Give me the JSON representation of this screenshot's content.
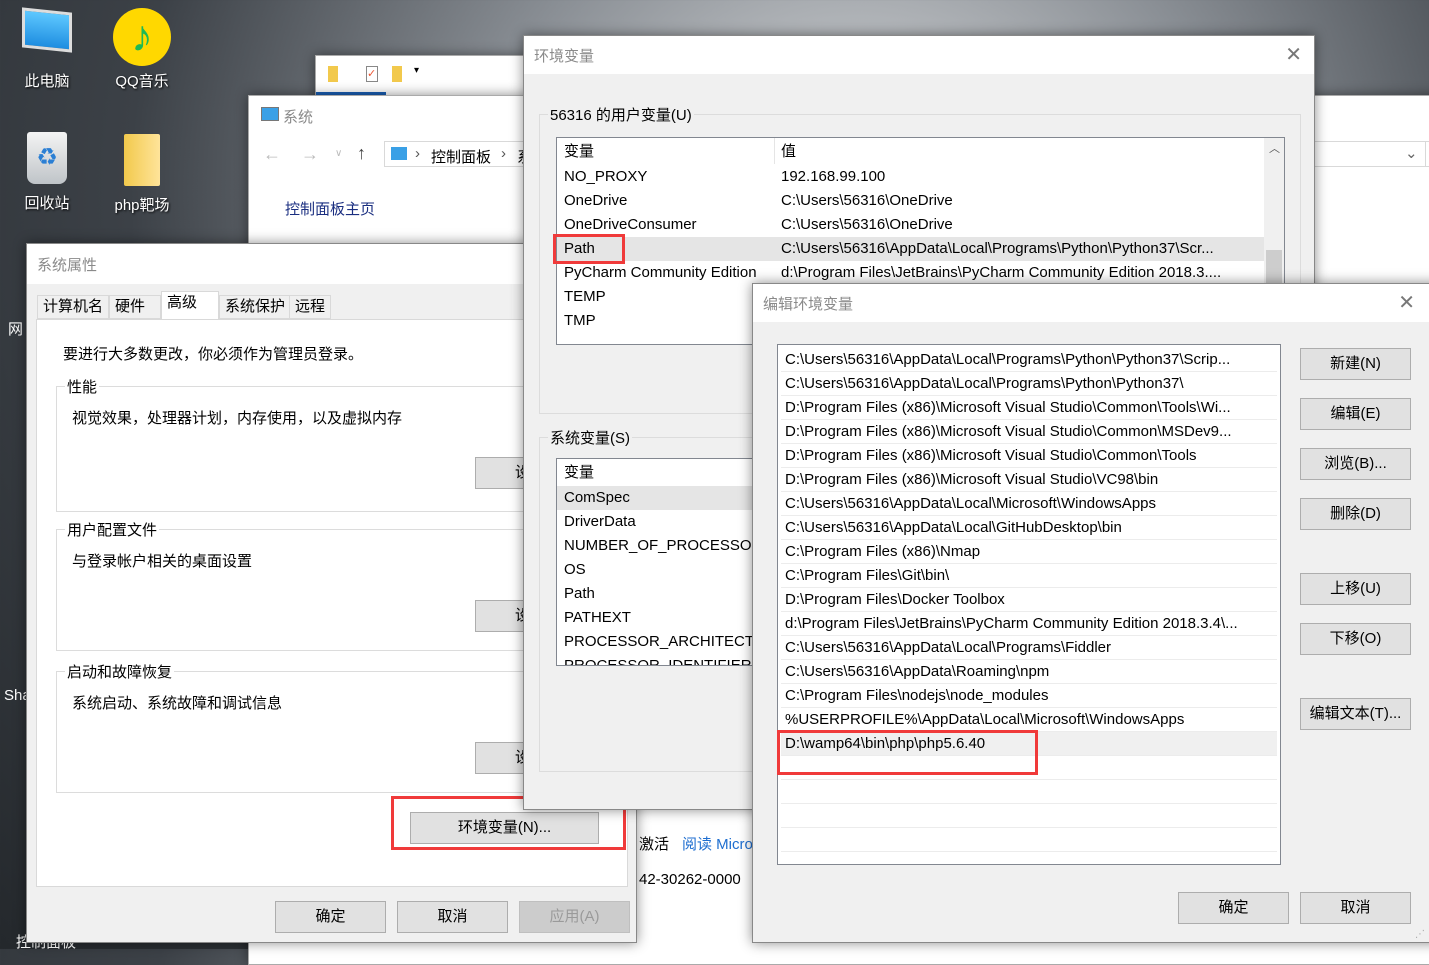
{
  "desktop": {
    "icons": [
      {
        "label": "此电脑",
        "icon": "computer-icon"
      },
      {
        "label": "QQ音乐",
        "icon": "music-note-icon"
      },
      {
        "label": "回收站",
        "icon": "recycle-bin-icon"
      },
      {
        "label": "php靶场",
        "icon": "folder-icon"
      }
    ],
    "partial_labels": [
      "网",
      "Sha",
      "控制面板"
    ]
  },
  "system_window": {
    "title": "系统",
    "breadcrumb": [
      "控制面板",
      "系"
    ],
    "home_link": "控制面板主页",
    "activate": "激活",
    "read_link": "阅读 Micro",
    "product_id": "42-30262-0000"
  },
  "system_props": {
    "title": "系统属性",
    "tabs": [
      "计算机名",
      "硬件",
      "高级",
      "系统保护",
      "远程"
    ],
    "active_tab": "高级",
    "admin_note": "要进行大多数更改，你必须作为管理员登录。",
    "groups": [
      {
        "label": "性能",
        "desc": "视觉效果，处理器计划，内存使用，以及虚拟内存",
        "button": "设置"
      },
      {
        "label": "用户配置文件",
        "desc": "与登录帐户相关的桌面设置",
        "button": "设置"
      },
      {
        "label": "启动和故障恢复",
        "desc": "系统启动、系统故障和调试信息",
        "button": "设置"
      }
    ],
    "env_button": "环境变量(N)...",
    "ok": "确定",
    "cancel": "取消",
    "apply": "应用(A)"
  },
  "env_dialog": {
    "title": "环境变量",
    "user_group": "56316 的用户变量(U)",
    "col_var": "变量",
    "col_val": "值",
    "user_vars": [
      [
        "NO_PROXY",
        "192.168.99.100"
      ],
      [
        "OneDrive",
        "C:\\Users\\56316\\OneDrive"
      ],
      [
        "OneDriveConsumer",
        "C:\\Users\\56316\\OneDrive"
      ],
      [
        "Path",
        "C:\\Users\\56316\\AppData\\Local\\Programs\\Python\\Python37\\Scr..."
      ],
      [
        "PyCharm Community Edition",
        "d:\\Program Files\\JetBrains\\PyCharm Community Edition 2018.3...."
      ],
      [
        "TEMP",
        ""
      ],
      [
        "TMP",
        ""
      ]
    ],
    "selected_user_var": "Path",
    "system_group": "系统变量(S)",
    "system_vars": [
      "ComSpec",
      "DriverData",
      "NUMBER_OF_PROCESSORS",
      "OS",
      "Path",
      "PATHEXT",
      "PROCESSOR_ARCHITECTURE",
      "PROCESSOR_IDENTIFIER"
    ],
    "selected_system_var": "ComSpec"
  },
  "edit_dialog": {
    "title": "编辑环境变量",
    "entries": [
      "C:\\Users\\56316\\AppData\\Local\\Programs\\Python\\Python37\\Scrip...",
      "C:\\Users\\56316\\AppData\\Local\\Programs\\Python\\Python37\\",
      "D:\\Program Files (x86)\\Microsoft Visual Studio\\Common\\Tools\\Wi...",
      "D:\\Program Files (x86)\\Microsoft Visual Studio\\Common\\MSDev9...",
      "D:\\Program Files (x86)\\Microsoft Visual Studio\\Common\\Tools",
      "D:\\Program Files (x86)\\Microsoft Visual Studio\\VC98\\bin",
      "C:\\Users\\56316\\AppData\\Local\\Microsoft\\WindowsApps",
      "C:\\Users\\56316\\AppData\\Local\\GitHubDesktop\\bin",
      "C:\\Program Files (x86)\\Nmap",
      "C:\\Program Files\\Git\\bin\\",
      "D:\\Program Files\\Docker Toolbox",
      "d:\\Program Files\\JetBrains\\PyCharm Community Edition 2018.3.4\\...",
      "C:\\Users\\56316\\AppData\\Local\\Programs\\Fiddler",
      "C:\\Users\\56316\\AppData\\Roaming\\npm",
      "C:\\Program Files\\nodejs\\node_modules",
      "%USERPROFILE%\\AppData\\Local\\Microsoft\\WindowsApps",
      "D:\\wamp64\\bin\\php\\php5.6.40",
      "",
      "",
      "",
      ""
    ],
    "selected_entry": "D:\\wamp64\\bin\\php\\php5.6.40",
    "buttons": {
      "new": "新建(N)",
      "edit": "编辑(E)",
      "browse": "浏览(B)...",
      "delete": "删除(D)",
      "up": "上移(U)",
      "down": "下移(O)",
      "edit_text": "编辑文本(T)..."
    },
    "ok": "确定",
    "cancel": "取消"
  },
  "colors": {
    "highlight": "#f03a3a",
    "selected_row": "#e5e5e5",
    "link": "#1e6ed0",
    "dialog_bg": "#f0f0f0"
  }
}
